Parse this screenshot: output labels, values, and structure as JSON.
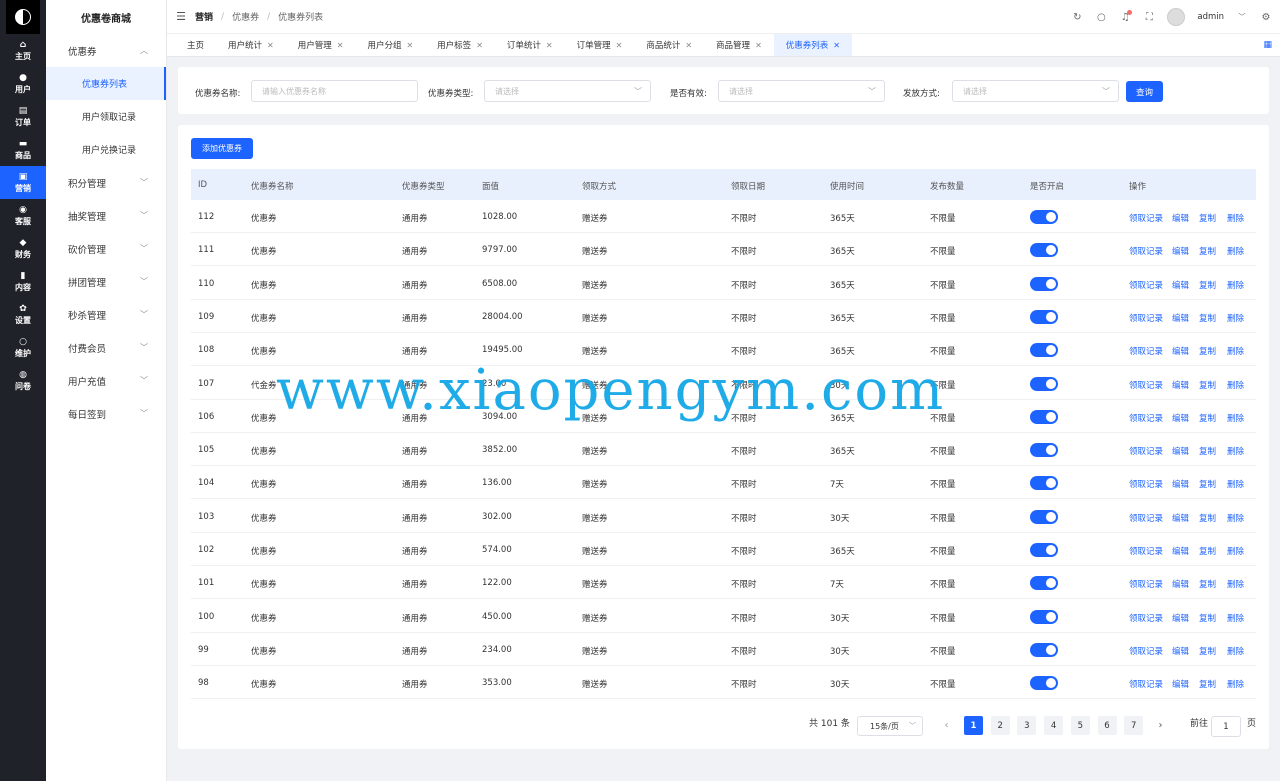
{
  "rail": [
    {
      "label": "主页",
      "icon": "home-icon",
      "glyph": "⌂"
    },
    {
      "label": "用户",
      "icon": "user-icon",
      "glyph": "●"
    },
    {
      "label": "订单",
      "icon": "order-icon",
      "glyph": "▤"
    },
    {
      "label": "商品",
      "icon": "goods-icon",
      "glyph": "▬"
    },
    {
      "label": "营销",
      "icon": "marketing-icon",
      "glyph": "▣",
      "active": true
    },
    {
      "label": "客服",
      "icon": "service-icon",
      "glyph": "◉"
    },
    {
      "label": "财务",
      "icon": "finance-icon",
      "glyph": "◆"
    },
    {
      "label": "内容",
      "icon": "content-icon",
      "glyph": "▮"
    },
    {
      "label": "设置",
      "icon": "settings-icon",
      "glyph": "✿"
    },
    {
      "label": "维护",
      "icon": "maintain-icon",
      "glyph": "○"
    },
    {
      "label": "问卷",
      "icon": "survey-icon",
      "glyph": "◍"
    }
  ],
  "submenu": {
    "brand": "优惠卷商城",
    "group": "优惠券",
    "group_children": [
      "优惠券列表",
      "用户领取记录",
      "用户兑换记录"
    ],
    "items": [
      "积分管理",
      "抽奖管理",
      "砍价管理",
      "拼团管理",
      "秒杀管理",
      "付费会员",
      "用户充值",
      "每日签到"
    ]
  },
  "header": {
    "breadcrumb": [
      "营销",
      "优惠券",
      "优惠券列表"
    ],
    "username": "admin"
  },
  "tabs": [
    "主页",
    "用户统计",
    "用户管理",
    "用户分组",
    "用户标签",
    "订单统计",
    "订单管理",
    "商品统计",
    "商品管理",
    "优惠券列表"
  ],
  "filter": {
    "name_label": "优惠券名称:",
    "name_placeholder": "请输入优惠券名称",
    "type_label": "优惠券类型:",
    "type_placeholder": "请选择",
    "valid_label": "是否有效:",
    "valid_placeholder": "请选择",
    "issue_label": "发放方式:",
    "issue_placeholder": "请选择",
    "query_label": "查询"
  },
  "add_label": "添加优惠券",
  "columns": [
    "ID",
    "优惠券名称",
    "优惠券类型",
    "面值",
    "领取方式",
    "领取日期",
    "使用时间",
    "发布数量",
    "是否开启",
    "操作"
  ],
  "actions": [
    "领取记录",
    "编辑",
    "复制",
    "删除"
  ],
  "rows": [
    {
      "id": "112",
      "name": "优惠券",
      "type": "通用券",
      "value": "1028.00",
      "method": "赠送券",
      "date": "不限时",
      "duration": "365天",
      "qty": "不限量",
      "enabled": true
    },
    {
      "id": "111",
      "name": "优惠券",
      "type": "通用券",
      "value": "9797.00",
      "method": "赠送券",
      "date": "不限时",
      "duration": "365天",
      "qty": "不限量",
      "enabled": true
    },
    {
      "id": "110",
      "name": "优惠券",
      "type": "通用券",
      "value": "6508.00",
      "method": "赠送券",
      "date": "不限时",
      "duration": "365天",
      "qty": "不限量",
      "enabled": true
    },
    {
      "id": "109",
      "name": "优惠券",
      "type": "通用券",
      "value": "28004.00",
      "method": "赠送券",
      "date": "不限时",
      "duration": "365天",
      "qty": "不限量",
      "enabled": true
    },
    {
      "id": "108",
      "name": "优惠券",
      "type": "通用券",
      "value": "19495.00",
      "method": "赠送券",
      "date": "不限时",
      "duration": "365天",
      "qty": "不限量",
      "enabled": true
    },
    {
      "id": "107",
      "name": "代金券",
      "type": "通用券",
      "value": "23.00",
      "method": "赠送券",
      "date": "不限时",
      "duration": "30天",
      "qty": "不限量",
      "enabled": true
    },
    {
      "id": "106",
      "name": "优惠券",
      "type": "通用券",
      "value": "3094.00",
      "method": "赠送券",
      "date": "不限时",
      "duration": "365天",
      "qty": "不限量",
      "enabled": true
    },
    {
      "id": "105",
      "name": "优惠券",
      "type": "通用券",
      "value": "3852.00",
      "method": "赠送券",
      "date": "不限时",
      "duration": "365天",
      "qty": "不限量",
      "enabled": true
    },
    {
      "id": "104",
      "name": "优惠券",
      "type": "通用券",
      "value": "136.00",
      "method": "赠送券",
      "date": "不限时",
      "duration": "7天",
      "qty": "不限量",
      "enabled": true
    },
    {
      "id": "103",
      "name": "优惠券",
      "type": "通用券",
      "value": "302.00",
      "method": "赠送券",
      "date": "不限时",
      "duration": "30天",
      "qty": "不限量",
      "enabled": true
    },
    {
      "id": "102",
      "name": "优惠券",
      "type": "通用券",
      "value": "574.00",
      "method": "赠送券",
      "date": "不限时",
      "duration": "365天",
      "qty": "不限量",
      "enabled": true
    },
    {
      "id": "101",
      "name": "优惠券",
      "type": "通用券",
      "value": "122.00",
      "method": "赠送券",
      "date": "不限时",
      "duration": "7天",
      "qty": "不限量",
      "enabled": true
    },
    {
      "id": "100",
      "name": "优惠券",
      "type": "通用券",
      "value": "450.00",
      "method": "赠送券",
      "date": "不限时",
      "duration": "30天",
      "qty": "不限量",
      "enabled": true
    },
    {
      "id": "99",
      "name": "优惠券",
      "type": "通用券",
      "value": "234.00",
      "method": "赠送券",
      "date": "不限时",
      "duration": "30天",
      "qty": "不限量",
      "enabled": true
    },
    {
      "id": "98",
      "name": "优惠券",
      "type": "通用券",
      "value": "353.00",
      "method": "赠送券",
      "date": "不限时",
      "duration": "30天",
      "qty": "不限量",
      "enabled": true
    }
  ],
  "pagination": {
    "total": "共 101 条",
    "page_size": "15条/页",
    "pages": [
      "1",
      "2",
      "3",
      "4",
      "5",
      "6",
      "7"
    ],
    "current": "1",
    "goto_label": "前往",
    "goto_value": "1",
    "page_suffix": "页"
  },
  "watermark": "www.xiaopengym.com",
  "colors": {
    "accent": "#1d63ff",
    "rail_bg": "#1f2329",
    "watermark": "#14a7e6"
  }
}
